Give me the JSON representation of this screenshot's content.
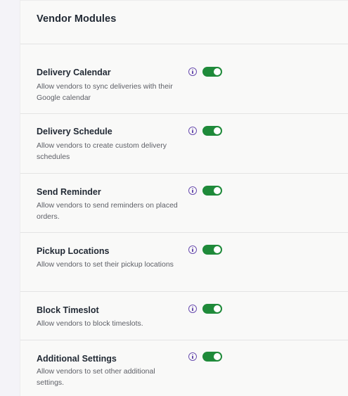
{
  "page": {
    "title": "Vendor Modules"
  },
  "modules": [
    {
      "title": "Delivery Calendar",
      "description": "Allow vendors to sync deliveries with their Google calendar",
      "enabled": true
    },
    {
      "title": "Delivery Schedule",
      "description": "Allow vendors to create custom delivery schedules",
      "enabled": true
    },
    {
      "title": "Send Reminder",
      "description": "Allow vendors to send reminders on placed orders.",
      "enabled": true
    },
    {
      "title": "Pickup Locations",
      "description": "Allow vendors to set their pickup locations",
      "enabled": true
    },
    {
      "title": "Block Timeslot",
      "description": "Allow vendors to block timeslots.",
      "enabled": true
    },
    {
      "title": "Additional Settings",
      "description": "Allow vendors to set other additional settings.",
      "enabled": true
    }
  ],
  "colors": {
    "toggle_on": "#1f8a3a",
    "info_icon": "#6b4fb0"
  },
  "icons": {
    "info": "info-icon"
  }
}
